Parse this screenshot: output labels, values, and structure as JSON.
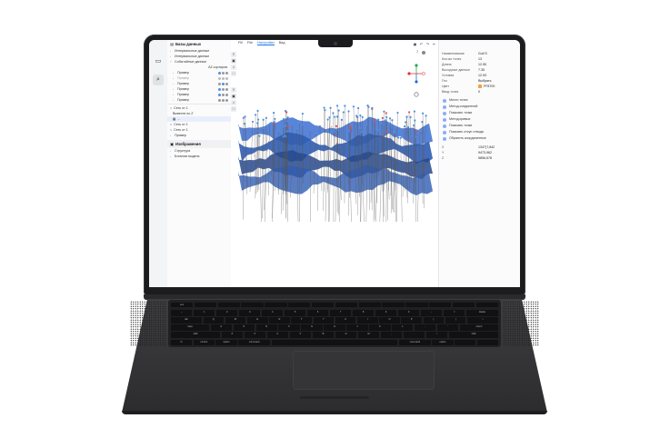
{
  "left_panel": {
    "data_header": "Базы данных",
    "items": [
      {
        "label": "Интервальные данные"
      },
      {
        "label": "Интервальные данные"
      },
      {
        "label": "Событийные данные"
      }
    ],
    "sort_label": "AZ сортиров",
    "wells": [
      {
        "label": "Пример"
      },
      {
        "label": "Пример"
      },
      {
        "label": "Пример"
      },
      {
        "label": "Пример"
      },
      {
        "label": "Пример"
      },
      {
        "label": "Пример"
      }
    ],
    "surfaces": [
      {
        "label": "Сеть от 1"
      },
      {
        "label": "Вывести по Z"
      },
      {
        "label": "Сеть от 1"
      },
      {
        "label": "Сеть от 1"
      },
      {
        "label": "Пример"
      }
    ],
    "images_header": "Изображения",
    "image_items": [
      {
        "label": "Структура"
      },
      {
        "label": "Блочная модель"
      }
    ]
  },
  "menu": [
    "Fill",
    "File",
    "Настройки",
    "Вид"
  ],
  "right_panel": {
    "props": [
      {
        "k": "Наименование",
        "v": "Gull S"
      },
      {
        "k": "Кол-во точек",
        "v": "13"
      },
      {
        "k": "Длина",
        "v": "12.55"
      },
      {
        "k": "Выходные данные",
        "v": "7.35"
      },
      {
        "k": "Угловая",
        "v": "12.93"
      },
      {
        "k": "Гео",
        "v": "Выбрать"
      },
      {
        "k": "Цвет",
        "v": "FF8700"
      },
      {
        "k": "Ввод точек",
        "v": "0"
      }
    ],
    "checks": [
      "Место точек",
      "Метод соединений",
      "Показать точки",
      "Метод кривых",
      "Показать точки",
      "Показать отсуп отвода",
      "Обратить координатные"
    ],
    "coords": [
      {
        "k": "X",
        "v": "1347(7,842"
      },
      {
        "k": "Y",
        "v": "9473,962"
      },
      {
        "k": "Z",
        "v": "5856,678"
      }
    ]
  },
  "keyboard_rows": [
    [
      "esc",
      "",
      "",
      "",
      "",
      "",
      "",
      "",
      "",
      "",
      "",
      "",
      "",
      ""
    ],
    [
      "~",
      "1",
      "2",
      "3",
      "4",
      "5",
      "6",
      "7",
      "8",
      "9",
      "0",
      "-",
      "=",
      "delete"
    ],
    [
      "tab",
      "Q",
      "W",
      "E",
      "R",
      "T",
      "Y",
      "U",
      "I",
      "O",
      "P",
      "[",
      "]",
      "\\"
    ],
    [
      "caps",
      "A",
      "S",
      "D",
      "F",
      "G",
      "H",
      "J",
      "K",
      "L",
      ";",
      "'",
      "return"
    ],
    [
      "shift",
      "Z",
      "X",
      "C",
      "V",
      "B",
      "N",
      "M",
      ",",
      ".",
      "/",
      "shift"
    ],
    [
      "fn",
      "control",
      "option",
      "command",
      "",
      "command",
      "option",
      "",
      ""
    ]
  ],
  "colors": {
    "accent": "#1a73e8",
    "point_blue": "#4a90e2",
    "surface_blue": "#2f5db4"
  }
}
